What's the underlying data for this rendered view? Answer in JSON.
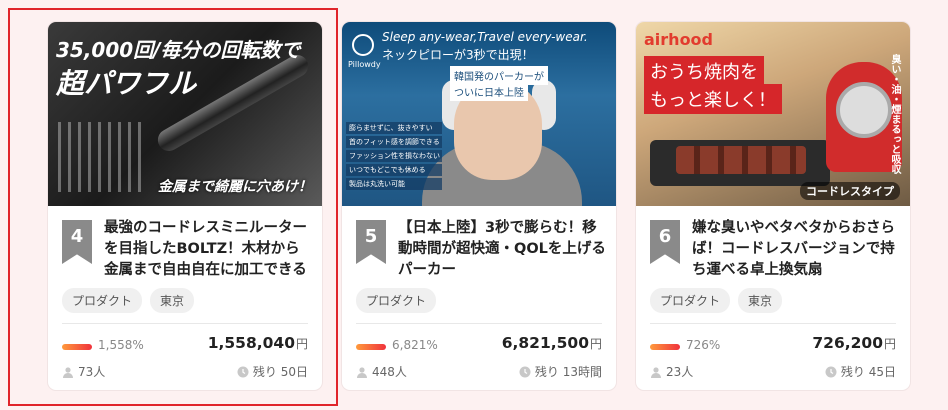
{
  "cards": [
    {
      "rank": "4",
      "title": "最強のコードレスミニルーターを目指したBOLTZ！木材から金属まで自由自在に加工できる",
      "tags": [
        "プロダクト",
        "東京"
      ],
      "percent": "1,558%",
      "amount": "1,558,040",
      "currency": "円",
      "supporters": "73人",
      "remaining": "残り 50日",
      "image": {
        "headline1": "35,000回/毎分の回転数で",
        "headline2": "超パワフル",
        "caption": "金属まで綺麗に穴あけ！"
      }
    },
    {
      "rank": "5",
      "title": "【日本上陸】3秒で膨らむ！移動時間が超快適・QOLを上げるパーカー",
      "tags": [
        "プロダクト"
      ],
      "percent": "6,821%",
      "amount": "6,821,500",
      "currency": "円",
      "supporters": "448人",
      "remaining": "残り 13時間",
      "image": {
        "headline1": "Sleep any-wear,Travel every-wear.",
        "headline2": "ネックピローが3秒で出現！",
        "brand": "Pillowdy",
        "badge1": "韓国発のパーカーが",
        "badge2": "ついに日本上陸",
        "features": [
          "膨らませずに、抜きやすい",
          "首のフィット感を調節できる",
          "ファッション性を損なわない",
          "いつでもどこでも休める",
          "製品は丸洗い可能"
        ]
      }
    },
    {
      "rank": "6",
      "title": "嫌な臭いやベタベタからおさらば！コードレスバージョンで持ち運べる卓上換気扇",
      "tags": [
        "プロダクト",
        "東京"
      ],
      "percent": "726%",
      "amount": "726,200",
      "currency": "円",
      "supporters": "23人",
      "remaining": "残り 45日",
      "image": {
        "brand": "airhood",
        "box1": "おうち焼肉を",
        "box2": "もっと楽しく！",
        "side": "臭い・油・煙まるっと吸収",
        "caption": "コードレスタイプ"
      }
    }
  ],
  "colors": {
    "accent_red": "#e0252b",
    "rank_gray": "#8a8a8a",
    "progress_start": "#ff9a3c",
    "progress_end": "#f0323c"
  }
}
